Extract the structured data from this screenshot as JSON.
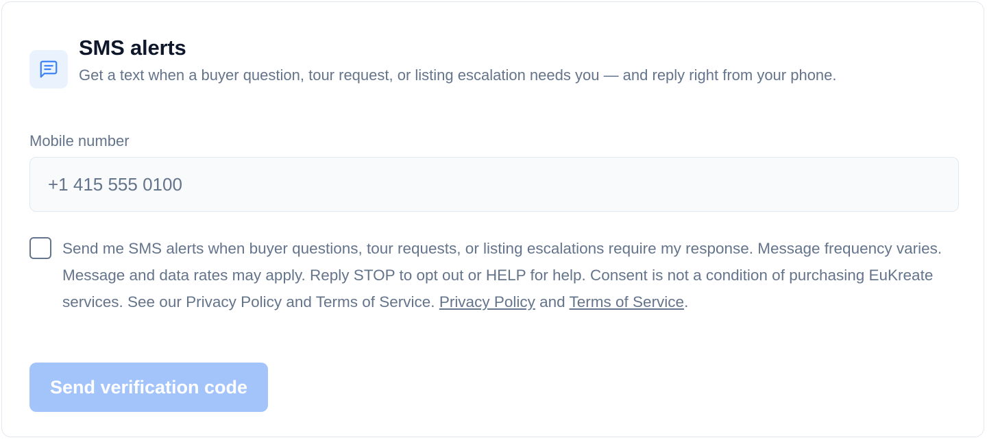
{
  "header": {
    "title": "SMS alerts",
    "description": "Get a text when a buyer question, tour request, or listing escalation needs you — and reply right from your phone.",
    "icon": "message-square-icon",
    "icon_color": "#3b82f6",
    "icon_bg": "#eaf2fe"
  },
  "phone_field": {
    "label": "Mobile number",
    "placeholder": "+1 415 555 0100",
    "value": ""
  },
  "consent": {
    "checked": false,
    "text": "Send me SMS alerts when buyer questions, tour requests, or listing escalations require my response. Message frequency varies. Message and data rates may apply. Reply STOP to opt out or HELP for help. Consent is not a condition of purchasing EuKreate services. See our Privacy Policy and Terms of Service.",
    "privacy_link": "Privacy Policy",
    "conjunction": "and",
    "terms_link": "Terms of Service",
    "terminator": "."
  },
  "actions": {
    "send_label": "Send verification code",
    "send_disabled": true,
    "button_color": "#a3c4fb"
  }
}
